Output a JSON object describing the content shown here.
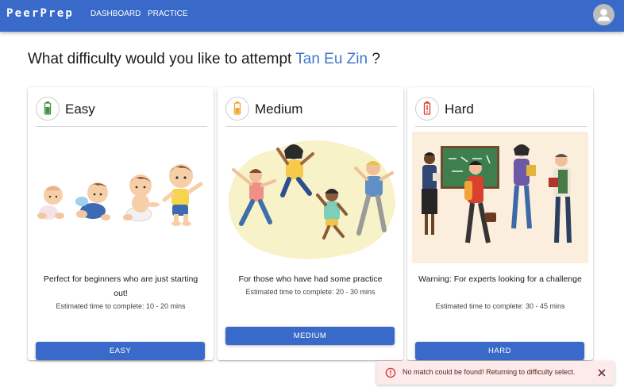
{
  "appbar": {
    "brand": "PeerPrep",
    "nav": {
      "dashboard": "DASHBOARD",
      "practice": "PRACTICE"
    }
  },
  "heading": {
    "prefix": "What difficulty would you like to attempt",
    "username": "Tan Eu Zin",
    "suffix": "?"
  },
  "cards": [
    {
      "title": "Easy",
      "description": "Perfect for beginners who are just starting out!",
      "estimate": "Estimated time to complete: 10 - 20 mins",
      "button": "EASY",
      "icon": "battery-low-icon",
      "accent": "#3f8f3f"
    },
    {
      "title": "Medium",
      "description": "For those who have had some practice",
      "estimate": "Estimated time to complete: 20 - 30 mins",
      "button": "MEDIUM",
      "icon": "battery-half-icon",
      "accent": "#f0a830"
    },
    {
      "title": "Hard",
      "description": "Warning: For experts looking for a challenge",
      "estimate": "Estimated time to complete: 30 - 45 mins",
      "button": "HARD",
      "icon": "battery-alert-icon",
      "accent": "#d83a2a"
    }
  ],
  "toast": {
    "message": "No match could be found! Returning to difficulty select.",
    "icon": "error-outline-icon",
    "close_icon": "close-icon"
  },
  "colors": {
    "primary": "#3a6ac9",
    "link": "#3f78c8",
    "error_bg": "#fcebea",
    "error_fg": "#d32f2f"
  }
}
